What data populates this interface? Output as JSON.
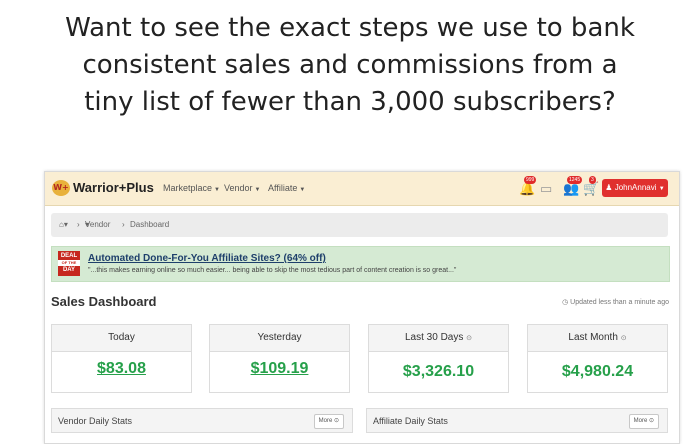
{
  "headline": [
    "Want to see the exact steps we use to bank",
    "consistent sales and commissions from a",
    "tiny list of fewer than 3,000 subscribers?"
  ],
  "navbar": {
    "logo_mark": "W+",
    "logo_text": "Warrior+Plus",
    "menu": [
      "Marketplace",
      "Vendor",
      "Affiliate"
    ],
    "badges": {
      "bell": "999",
      "inbox": "",
      "users": "1245",
      "cart": "3"
    },
    "user": "JohnAnnavi"
  },
  "breadcrumb": {
    "items": [
      "Vendor",
      "Dashboard"
    ]
  },
  "deal": {
    "badge_top": "DEAL",
    "badge_mid": "OF THE",
    "badge_bottom": "DAY",
    "title": "Automated Done-For-You Affiliate Sites? (64% off)",
    "description": "\"...this makes earning online so much easier... being able to skip the most tedious part of content creation is so great...\""
  },
  "dashboard": {
    "title": "Sales Dashboard",
    "updated": "Updated less than a minute ago",
    "cards": [
      {
        "label": "Today",
        "value": "$83.08"
      },
      {
        "label": "Yesterday",
        "value": "$109.19"
      },
      {
        "label": "Last 30 Days",
        "value": "$3,326.10"
      },
      {
        "label": "Last Month",
        "value": "$4,980.24"
      }
    ]
  },
  "panels": [
    {
      "label": "Vendor Daily Stats",
      "more": "More"
    },
    {
      "label": "Affiliate Daily Stats",
      "more": "More"
    }
  ],
  "colors": {
    "accent_red": "#e0302e",
    "value_green": "#26a04a",
    "navbar_bg": "#faeed3",
    "deal_bg": "#d5ead3"
  }
}
